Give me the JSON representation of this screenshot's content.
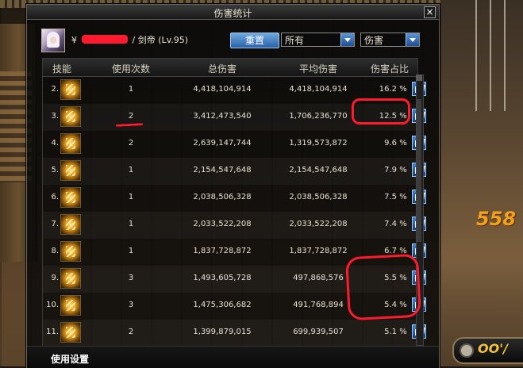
{
  "window": {
    "title": "伤害统计",
    "close": "×"
  },
  "header": {
    "name_prefix": "¥",
    "char_class": "/ 剑帝",
    "level": "(Lv.95)",
    "reset_label": "重置",
    "filter_select": "所有",
    "metric_select": "伤害"
  },
  "table": {
    "columns": [
      "技能",
      "使用次数",
      "总伤害",
      "平均伤害",
      "伤害占比"
    ],
    "rows": [
      {
        "idx": "2.",
        "uses": "1",
        "total": "4,418,104,914",
        "avg": "4,418,104,914",
        "pct": "16.2",
        "sign": "%",
        "icon": "golden-fan-skill-icon"
      },
      {
        "idx": "3.",
        "uses": "2",
        "total": "3,412,473,540",
        "avg": "1,706,236,770",
        "pct": "12.5",
        "sign": "%",
        "icon": "golden-swirl-skill-icon"
      },
      {
        "idx": "4.",
        "uses": "2",
        "total": "2,639,147,744",
        "avg": "1,319,573,872",
        "pct": "9.6",
        "sign": "%",
        "icon": "golden-burst-skill-icon"
      },
      {
        "idx": "5.",
        "uses": "1",
        "total": "2,154,547,648",
        "avg": "2,154,547,648",
        "pct": "7.9",
        "sign": "%",
        "icon": "golden-slash-skill-icon"
      },
      {
        "idx": "6.",
        "uses": "1",
        "total": "2,038,506,328",
        "avg": "2,038,506,328",
        "pct": "7.5",
        "sign": "%",
        "icon": "crossed-blades-skill-icon"
      },
      {
        "idx": "7.",
        "uses": "1",
        "total": "2,033,522,208",
        "avg": "2,033,522,208",
        "pct": "7.4",
        "sign": "%",
        "icon": "golden-hand-skill-icon"
      },
      {
        "idx": "8.",
        "uses": "1",
        "total": "1,837,728,872",
        "avg": "1,837,728,872",
        "pct": "6.7",
        "sign": "%",
        "icon": "golden-wave-skill-icon"
      },
      {
        "idx": "9.",
        "uses": "3",
        "total": "1,493,605,728",
        "avg": "497,868,576",
        "pct": "5.5",
        "sign": "%",
        "icon": "golden-rain-skill-icon"
      },
      {
        "idx": "10.",
        "uses": "3",
        "total": "1,475,306,682",
        "avg": "491,768,894",
        "pct": "5.4",
        "sign": "%",
        "icon": "golden-spiral-skill-icon"
      },
      {
        "idx": "11.",
        "uses": "2",
        "total": "1,399,879,015",
        "avg": "699,939,507",
        "pct": "5.1",
        "sign": "%",
        "icon": "golden-gear-skill-icon"
      }
    ]
  },
  "footer": {
    "settings_label": "使用设置"
  },
  "background": {
    "combo_text": "558",
    "hud_text": "OO'/"
  }
}
